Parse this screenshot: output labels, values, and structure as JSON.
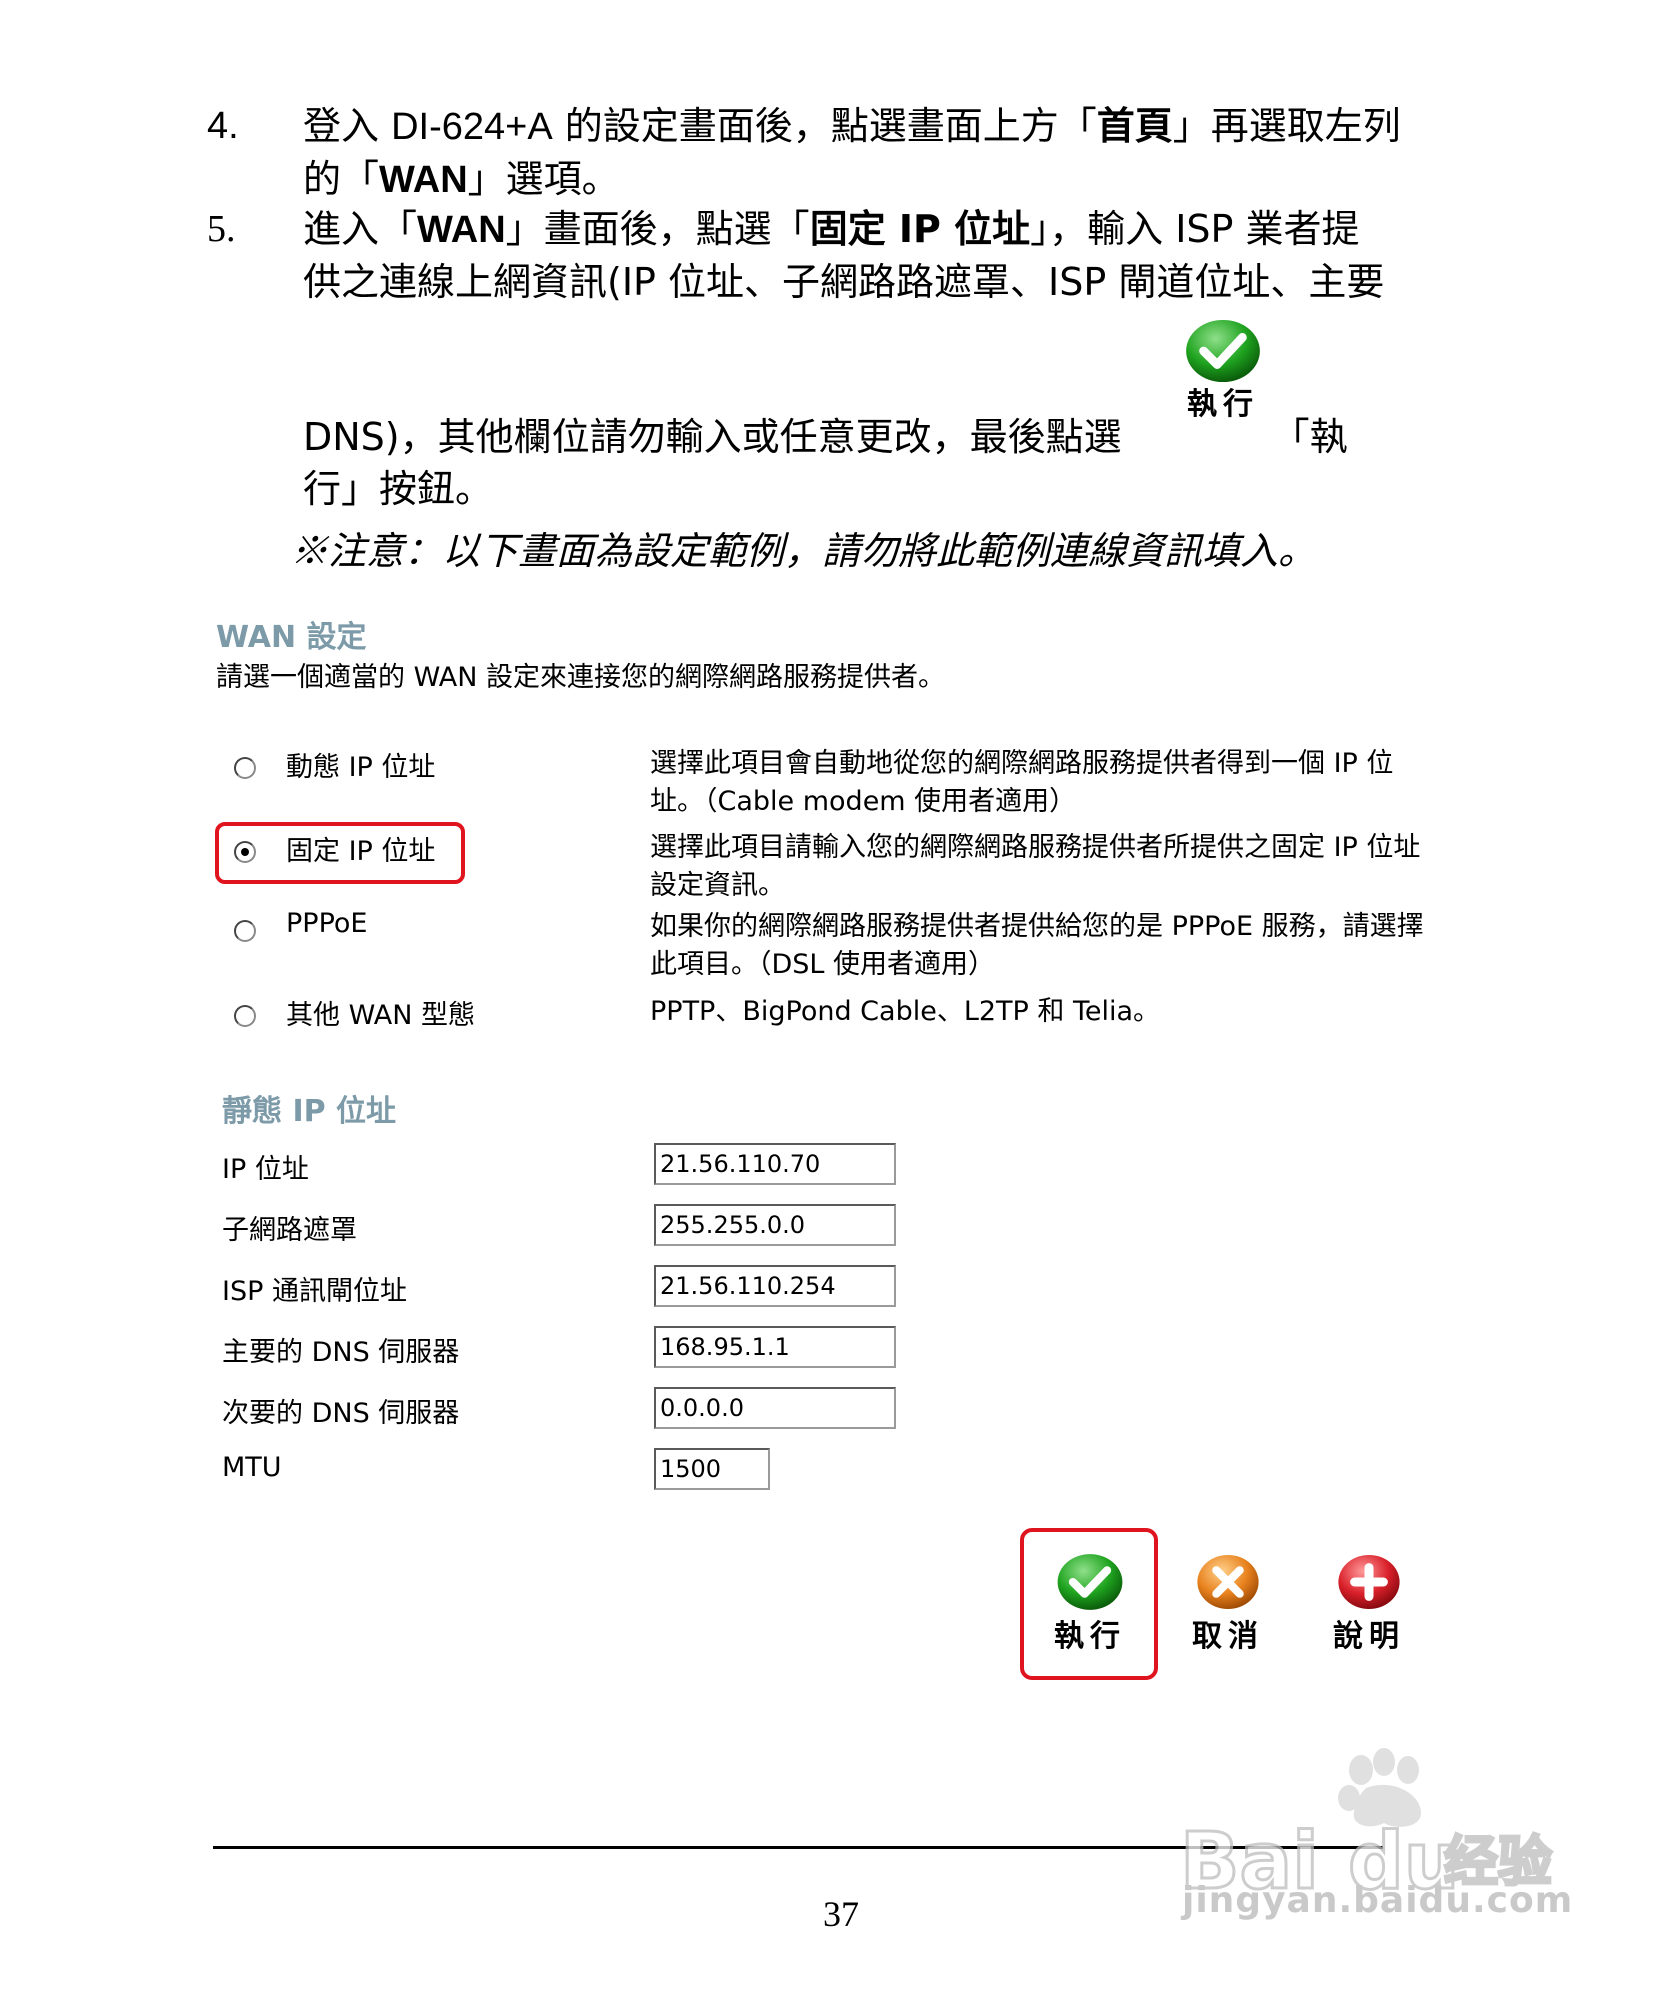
{
  "instructions": {
    "step4": {
      "number": "4.",
      "line1_a": "登入 ",
      "line1_b": "DI-624+A",
      "line1_c": " 的設定畫面後，點選畫面上方「",
      "line1_d": "首頁",
      "line1_e": "」再選取左列",
      "line2_a": "的「",
      "line2_b": "WAN",
      "line2_c": "」選項。"
    },
    "step5": {
      "number": "5.",
      "line1_a": "進入「",
      "line1_b": "WAN",
      "line1_c": "」畫面後，點選「",
      "line1_d": "固定 IP 位址",
      "line1_e": "」，輸入 ISP 業者提",
      "line2": "供之連線上網資訊(IP 位址、子網路路遮罩、ISP 閘道位址、主要",
      "line3_a": "DNS)，其他欄位請勿輸入或任意更改，最後點選",
      "line3_b": "「執",
      "line4": "行」按鈕。",
      "inline_button_label": "執行"
    },
    "note": "※注意：以下畫面為設定範例，請勿將此範例連線資訊填入。"
  },
  "wan": {
    "title": "WAN 設定",
    "description": "請選一個適當的 WAN 設定來連接您的網際網路服務提供者。",
    "options": [
      {
        "label": "動態 IP 位址",
        "desc": "選擇此項目會自動地從您的網際網路服務提供者得到一個 IP 位址。（Cable modem 使用者適用）",
        "selected": false
      },
      {
        "label": "固定 IP 位址",
        "desc": "選擇此項目請輸入您的網際網路服務提供者所提供之固定 IP 位址設定資訊。",
        "selected": true
      },
      {
        "label": "PPPoE",
        "desc": "如果你的網際網路服務提供者提供給您的是 PPPoE 服務，請選擇此項目。（DSL 使用者適用）",
        "selected": false
      },
      {
        "label": "其他 WAN 型態",
        "desc": "PPTP、BigPond Cable、L2TP 和 Telia。",
        "selected": false
      }
    ]
  },
  "static_ip": {
    "title": "靜態 IP 位址",
    "fields": [
      {
        "label": "IP 位址",
        "value": "21.56.110.70"
      },
      {
        "label": "子網路遮罩",
        "value": "255.255.0.0"
      },
      {
        "label": "ISP 通訊閘位址",
        "value": "21.56.110.254"
      },
      {
        "label": "主要的 DNS 伺服器",
        "value": "168.95.1.1"
      },
      {
        "label": "次要的 DNS 伺服器",
        "value": "0.0.0.0"
      },
      {
        "label": "MTU",
        "value": "1500"
      }
    ]
  },
  "buttons": {
    "execute": "執行",
    "cancel": "取消",
    "help": "說明"
  },
  "page_number": "37",
  "watermark": {
    "brand": "Bai",
    "brand2": "du",
    "product": "经验",
    "url": "jingyan.baidu.com"
  },
  "colors": {
    "highlight": "#e0141e",
    "section_title": "#7c9aa8",
    "ok_green": "#1fa31f",
    "cancel_orange": "#e8821e",
    "help_red": "#d9202a"
  }
}
